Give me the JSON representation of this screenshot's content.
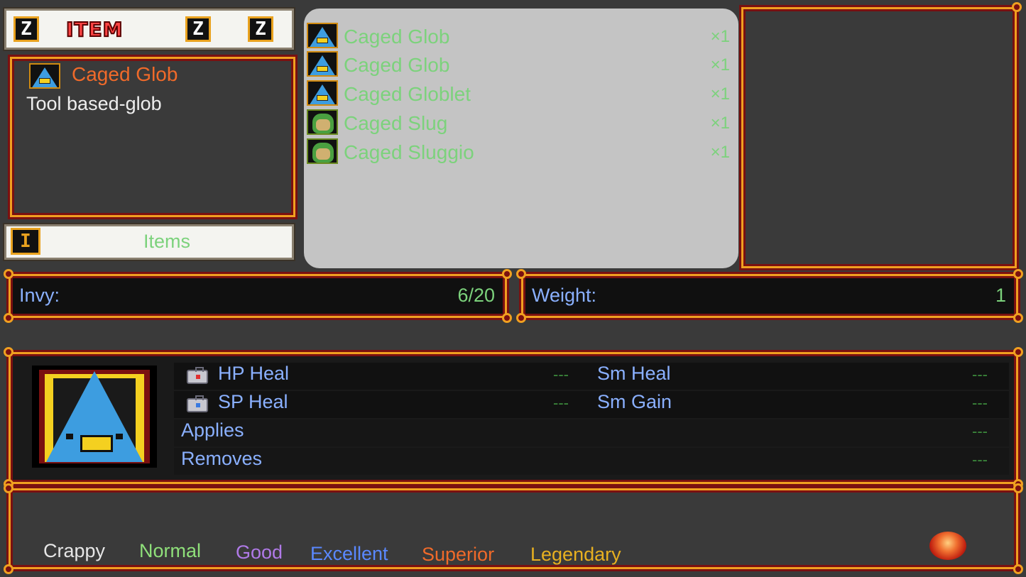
{
  "header": {
    "logo_text": "ITEM",
    "left_button_key": "Z",
    "right_button_1_key": "Z",
    "right_button_2_key": "Z"
  },
  "selected_item": {
    "name": "Caged Glob",
    "description": "Tool based-glob",
    "name_color": "#f06a2a"
  },
  "category": {
    "icon_key": "I",
    "label": "Items"
  },
  "item_list": [
    {
      "name": "Caged Glob",
      "qty": "×1",
      "icon": "glob-icon"
    },
    {
      "name": "Caged Glob",
      "qty": "×1",
      "icon": "glob-icon"
    },
    {
      "name": "Caged Globlet",
      "qty": "×1",
      "icon": "glob-icon"
    },
    {
      "name": "Caged Slug",
      "qty": "×1",
      "icon": "slug-icon"
    },
    {
      "name": "Caged Sluggio",
      "qty": "×1",
      "icon": "slug-icon"
    }
  ],
  "inventory": {
    "invy_label": "Invy:",
    "invy_value": "6/20",
    "weight_label": "Weight:",
    "weight_value": "1"
  },
  "stats": {
    "hp_heal_label": "HP Heal",
    "hp_heal_value": "---",
    "sp_heal_label": "SP Heal",
    "sp_heal_value": "---",
    "sm_heal_label": "Sm Heal",
    "sm_heal_value": "---",
    "sm_gain_label": "Sm Gain",
    "sm_gain_value": "---",
    "applies_label": "Applies",
    "applies_value": "---",
    "removes_label": "Removes",
    "removes_value": "---"
  },
  "rarity_legend": [
    {
      "label": "Crappy",
      "color": "#e6e6e6"
    },
    {
      "label": "Normal",
      "color": "#8fe07a"
    },
    {
      "label": "Good",
      "color": "#b07ae8"
    },
    {
      "label": "Excellent",
      "color": "#5a88ff"
    },
    {
      "label": "Superior",
      "color": "#f06a2a"
    },
    {
      "label": "Legendary",
      "color": "#e8b020"
    }
  ]
}
